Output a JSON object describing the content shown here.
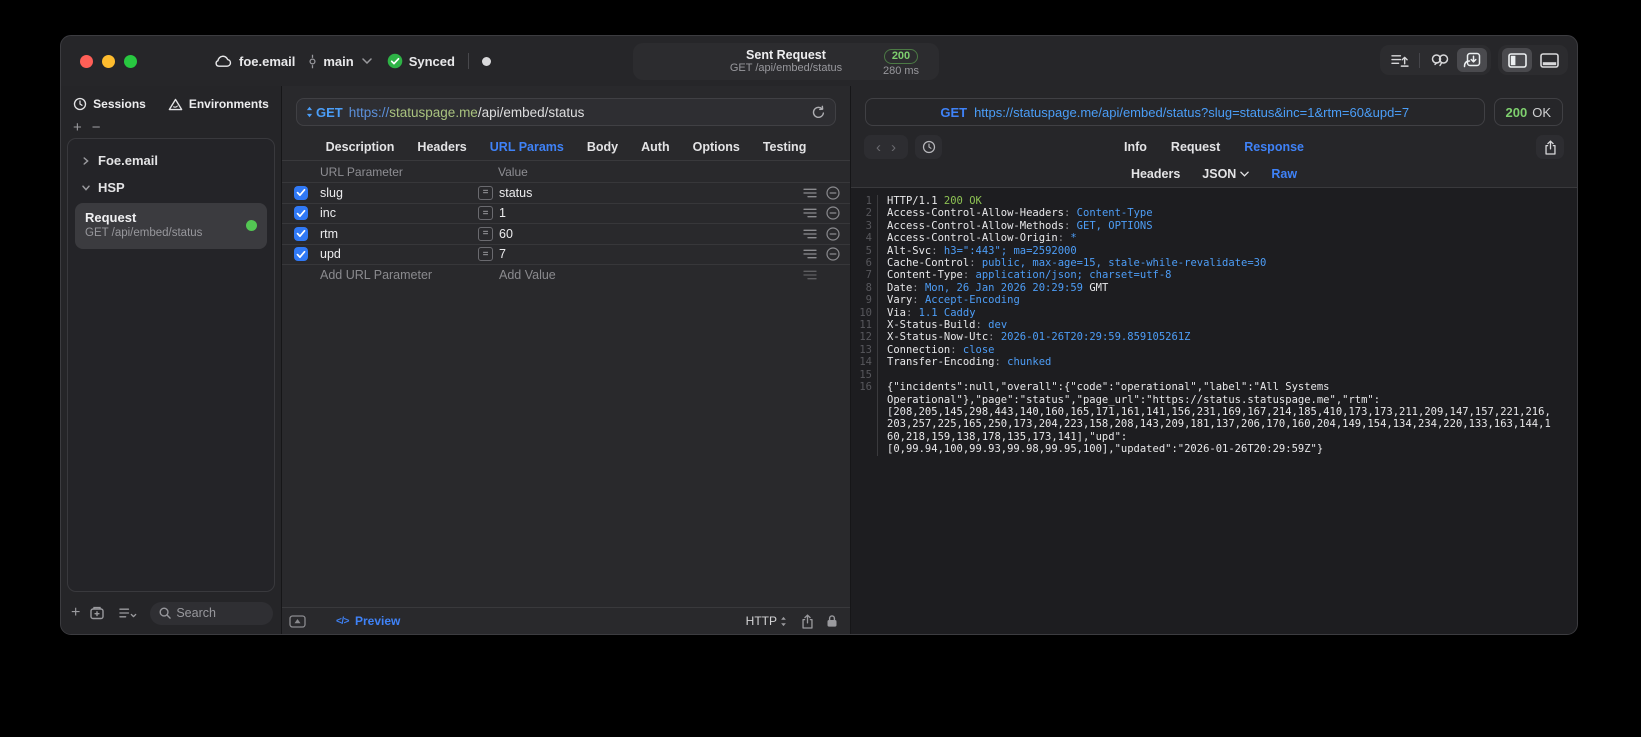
{
  "colors": {
    "accent_blue": "#3f82f7",
    "url_blue": "#4b9ef8",
    "host_green": "#a9c27f",
    "status_green": "#7ecf6e",
    "success_dot": "#53c653",
    "checkbox_blue": "#3079f6"
  },
  "titlebar": {
    "project": "foe.email",
    "branch": "main",
    "sync_status": "Synced",
    "request_pill": {
      "title": "Sent Request",
      "subtitle": "GET /api/embed/status",
      "status_code": "200",
      "duration": "280 ms"
    },
    "tool_icons": [
      "import-icon",
      "unlink-icon",
      "send-to-window-icon",
      "layout-sidebar-left-icon",
      "layout-bottom-panel-icon"
    ]
  },
  "sidebar": {
    "tabs": [
      {
        "label": "Sessions",
        "icon": "clock-icon"
      },
      {
        "label": "Environments",
        "icon": "environments-icon"
      }
    ],
    "tree": [
      {
        "label": "Foe.email",
        "expanded": false
      },
      {
        "label": "HSP",
        "expanded": true
      }
    ],
    "request_item": {
      "title": "Request",
      "subtitle": "GET /api/embed/status",
      "status": "ok"
    },
    "search_placeholder": "Search"
  },
  "request_panel": {
    "method": "GET",
    "url_scheme": "https://",
    "url_host": "statuspage.me",
    "url_path": "/api/embed/status",
    "tabs": [
      {
        "label": "Description"
      },
      {
        "label": "Headers"
      },
      {
        "label": "URL Params",
        "active": true
      },
      {
        "label": "Body"
      },
      {
        "label": "Auth"
      },
      {
        "label": "Options"
      },
      {
        "label": "Testing"
      }
    ],
    "param_table": {
      "columns": [
        "URL Parameter",
        "Value"
      ],
      "rows": [
        {
          "enabled": true,
          "name": "slug",
          "value": "status"
        },
        {
          "enabled": true,
          "name": "inc",
          "value": "1"
        },
        {
          "enabled": true,
          "name": "rtm",
          "value": "60"
        },
        {
          "enabled": true,
          "name": "upd",
          "value": "7"
        }
      ],
      "add_row": {
        "name_placeholder": "Add URL Parameter",
        "value_placeholder": "Add Value"
      }
    },
    "footer": {
      "preview_label": "Preview",
      "code_glyph": "</>",
      "protocol": "HTTP"
    }
  },
  "response_panel": {
    "method": "GET",
    "url": "https://statuspage.me/api/embed/status?slug=status&inc=1&rtm=60&upd=7",
    "status_code": "200",
    "status_text": "OK",
    "tabs": [
      {
        "label": "Info"
      },
      {
        "label": "Request"
      },
      {
        "label": "Response",
        "active": true
      }
    ],
    "subtabs": [
      {
        "label": "Headers"
      },
      {
        "label": "JSON",
        "dropdown": true
      },
      {
        "label": "Raw",
        "active": true
      }
    ],
    "body_lines": [
      {
        "n": "1",
        "segs": [
          [
            "HTTP/1.1 ",
            "w"
          ],
          [
            "200 OK",
            "g"
          ]
        ]
      },
      {
        "n": "2",
        "segs": [
          [
            "Access-Control-Allow-Headers",
            "w"
          ],
          [
            ": ",
            "d"
          ],
          [
            "Content-Type",
            "b"
          ]
        ]
      },
      {
        "n": "3",
        "segs": [
          [
            "Access-Control-Allow-Methods",
            "w"
          ],
          [
            ": ",
            "d"
          ],
          [
            "GET, OPTIONS",
            "b"
          ]
        ]
      },
      {
        "n": "4",
        "segs": [
          [
            "Access-Control-Allow-Origin",
            "w"
          ],
          [
            ": ",
            "d"
          ],
          [
            "*",
            "b"
          ]
        ]
      },
      {
        "n": "5",
        "segs": [
          [
            "Alt-Svc",
            "w"
          ],
          [
            ": ",
            "d"
          ],
          [
            "h3=\":443\"; ma=2592000",
            "b"
          ]
        ]
      },
      {
        "n": "6",
        "segs": [
          [
            "Cache-Control",
            "w"
          ],
          [
            ": ",
            "d"
          ],
          [
            "public, max-age=15, stale-while-revalidate=30",
            "b"
          ]
        ]
      },
      {
        "n": "7",
        "segs": [
          [
            "Content-Type",
            "w"
          ],
          [
            ": ",
            "d"
          ],
          [
            "application/json; charset=utf-8",
            "b"
          ]
        ]
      },
      {
        "n": "8",
        "segs": [
          [
            "Date",
            "w"
          ],
          [
            ": ",
            "d"
          ],
          [
            "Mon, 26 Jan 2026 20:29:59 ",
            "b"
          ],
          [
            "GMT",
            "w"
          ]
        ]
      },
      {
        "n": "9",
        "segs": [
          [
            "Vary",
            "w"
          ],
          [
            ": ",
            "d"
          ],
          [
            "Accept-Encoding",
            "b"
          ]
        ]
      },
      {
        "n": "10",
        "segs": [
          [
            "Via",
            "w"
          ],
          [
            ": ",
            "d"
          ],
          [
            "1.1 Caddy",
            "b"
          ]
        ]
      },
      {
        "n": "11",
        "segs": [
          [
            "X-Status-Build",
            "w"
          ],
          [
            ": ",
            "d"
          ],
          [
            "dev",
            "b"
          ]
        ]
      },
      {
        "n": "12",
        "segs": [
          [
            "X-Status-Now-Utc",
            "w"
          ],
          [
            ": ",
            "d"
          ],
          [
            "2026-01-26T20:29:59.859105261Z",
            "b"
          ]
        ]
      },
      {
        "n": "13",
        "segs": [
          [
            "Connection",
            "w"
          ],
          [
            ": ",
            "d"
          ],
          [
            "close",
            "b"
          ]
        ]
      },
      {
        "n": "14",
        "segs": [
          [
            "Transfer-Encoding",
            "w"
          ],
          [
            ": ",
            "d"
          ],
          [
            "chunked",
            "b"
          ]
        ]
      },
      {
        "n": "15",
        "segs": []
      },
      {
        "n": "16",
        "wrap": [
          "{\"incidents\":null,\"overall\":{\"code\":\"operational\",\"label\":\"All Systems",
          "Operational\"},\"page\":\"status\",\"page_url\":\"https://status.statuspage.me\",\"rtm\":",
          "[208,205,145,298,443,140,160,165,171,161,141,156,231,169,167,214,185,410,173,173,211,209,147,157,221,216,",
          "203,257,225,165,250,173,204,223,158,208,143,209,181,137,206,170,160,204,149,154,134,234,220,133,163,144,1",
          "60,218,159,138,178,135,173,141],\"upd\":",
          "[0,99.94,100,99.93,99.98,99.95,100],\"updated\":\"2026-01-26T20:29:59Z\"}"
        ]
      }
    ]
  }
}
